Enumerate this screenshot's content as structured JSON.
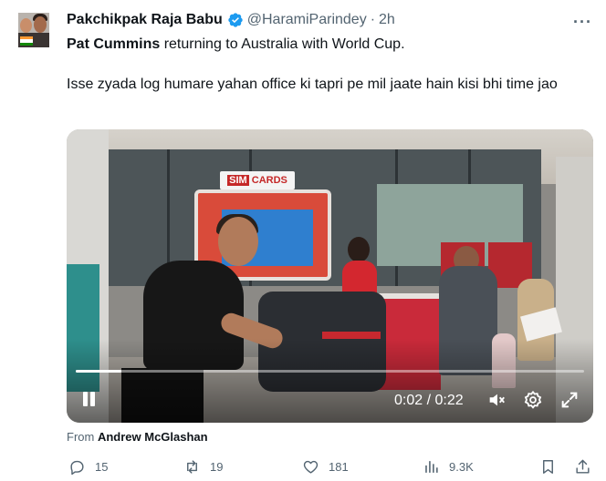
{
  "tweet": {
    "author_name": "Pakchikpak Raja Babu",
    "handle": "@HaramiParindey",
    "separator": "·",
    "time": "2h",
    "more_icon": "more-horizontal-icon",
    "verified_icon": "verified-badge-icon",
    "text_bold": "Pat Cummins",
    "text_line1_rest": " returning to Australia with World Cup.",
    "text_para2": "Isse zyada log humare yahan office ki tapri pe mil jaate hain kisi bhi time jao",
    "accent_color": "#1d9bf0"
  },
  "video": {
    "sign_brand": "SIM",
    "sign_word": "CARDS",
    "time_display": "0:02 / 0:22",
    "progress_fraction": 0.09,
    "controls": [
      "pause-icon",
      "mute-icon",
      "settings-gear-icon",
      "fullscreen-icon"
    ]
  },
  "source": {
    "prefix": "From ",
    "name": "Andrew McGlashan"
  },
  "actions": {
    "replies": "15",
    "reposts": "19",
    "likes": "181",
    "views": "9.3K"
  }
}
